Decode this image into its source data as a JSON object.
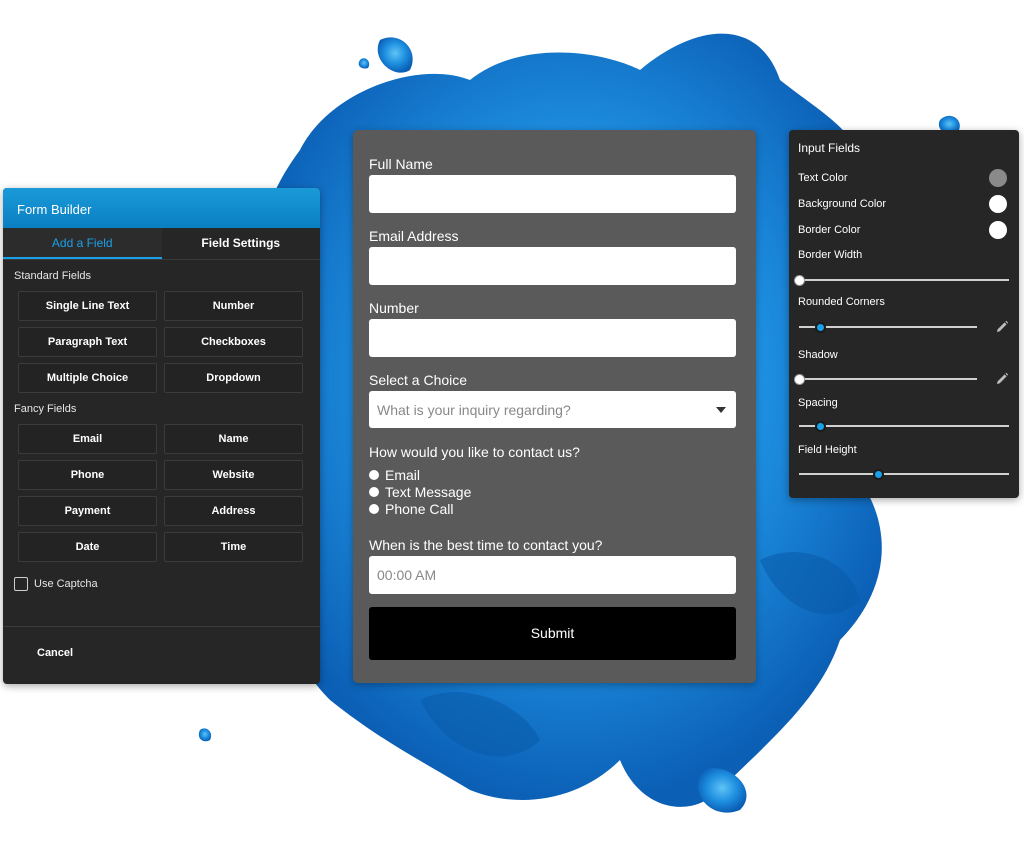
{
  "colors": {
    "accent": "#1aa0e8",
    "builder_bg": "#262626",
    "form_bg": "#5a5a5a",
    "text_color_swatch": "#8a8a8a",
    "background_color_swatch": "#ffffff",
    "border_color_swatch": "#ffffff"
  },
  "builder": {
    "title": "Form Builder",
    "tabs": [
      {
        "label": "Add a Field",
        "active": true
      },
      {
        "label": "Field Settings",
        "active": false
      }
    ],
    "standard_label": "Standard Fields",
    "standard_fields": [
      "Single Line Text",
      "Number",
      "Paragraph Text",
      "Checkboxes",
      "Multiple Choice",
      "Dropdown"
    ],
    "fancy_label": "Fancy Fields",
    "fancy_fields": [
      "Email",
      "Name",
      "Phone",
      "Website",
      "Payment",
      "Address",
      "Date",
      "Time"
    ],
    "captcha_label": "Use Captcha",
    "captcha_checked": false,
    "cancel_label": "Cancel"
  },
  "form": {
    "full_name_label": "Full Name",
    "email_label": "Email Address",
    "number_label": "Number",
    "choice_label": "Select a Choice",
    "choice_placeholder": "What is your inquiry regarding?",
    "contact_label": "How would you like to contact us?",
    "contact_options": [
      "Email",
      "Text Message",
      "Phone Call"
    ],
    "time_label": "When is the best time to contact you?",
    "time_placeholder": "00:00 AM",
    "submit_label": "Submit"
  },
  "style_panel": {
    "title": "Input Fields",
    "text_color_label": "Text Color",
    "background_color_label": "Background Color",
    "border_color_label": "Border Color",
    "border_width_label": "Border Width",
    "border_width_level": 0,
    "rounded_corners_label": "Rounded Corners",
    "rounded_corners_level": 0.12,
    "shadow_label": "Shadow",
    "shadow_level": 0,
    "spacing_label": "Spacing",
    "spacing_level": 0.1,
    "field_height_label": "Field Height",
    "field_height_level": 0.38
  }
}
